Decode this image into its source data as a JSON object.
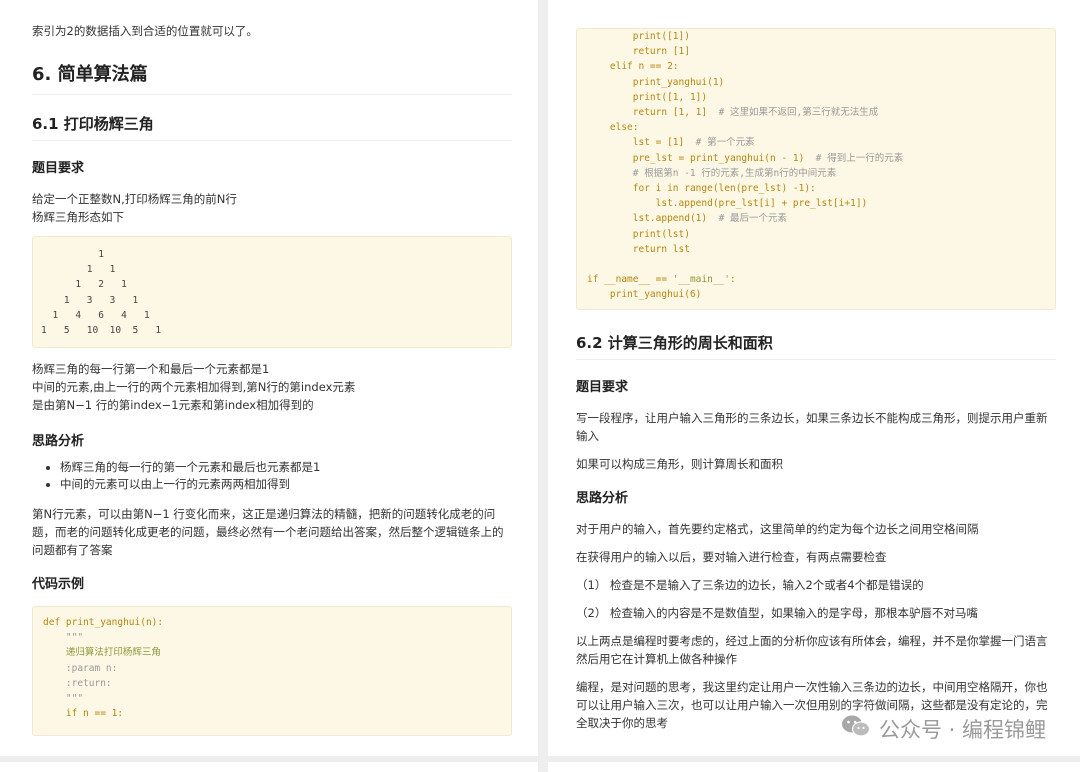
{
  "left": {
    "intro_line": "索引为2的数据插入到合适的位置就可以了。",
    "section_title": "6. 简单算法篇",
    "sub_title": "6.1 打印杨辉三角",
    "req_heading": "题目要求",
    "req_line1": "给定一个正整数N,打印杨辉三角的前N行",
    "req_line2": "杨辉三角形态如下",
    "triangle": "          1\n        1   1\n      1   2   1\n    1   3   3   1\n  1   4   6   4   1\n1   5   10  10  5   1",
    "desc_line1": "杨辉三角的每一行第一个和最后一个元素都是1",
    "desc_line2": "中间的元素,由上一行的两个元素相加得到,第N行的第index元素",
    "desc_line3": "是由第N−1 行的第index−1元素和第index相加得到的",
    "analysis_heading": "思路分析",
    "bullet1": "杨辉三角的每一行的第一个元素和最后也元素都是1",
    "bullet2": "中间的元素可以由上一行的元素两两相加得到",
    "analysis_para": "第N行元素，可以由第N−1 行变化而来，这正是递归算法的精髓，把新的问题转化成老的问题，而老的问题转化成更老的问题，最终必然有一个老问题给出答案，然后整个逻辑链条上的问题都有了答案",
    "code_heading": "代码示例",
    "code_l1": "def print_yanghui(n):",
    "code_l2": "    \"\"\"",
    "code_l3": "    递归算法打印杨辉三角",
    "code_l4": "    :param n:",
    "code_l5": "    :return:",
    "code_l6": "    \"\"\"",
    "code_l7": "    if n == 1:"
  },
  "right": {
    "c1": "        print([1])",
    "c2": "        return [1]",
    "c3": "    elif n == 2:",
    "c4": "        print_yanghui(1)",
    "c5": "        print([1, 1])",
    "c6": "        return [1, 1]  ",
    "c6_comment": "# 这里如果不返回,第三行就无法生成",
    "c7": "    else:",
    "c8": "        lst = [1]  ",
    "c8_comment": "# 第一个元素",
    "c9": "        pre_lst = print_yanghui(n - 1)  ",
    "c9_comment": "# 得到上一行的元素",
    "c10_comment": "        # 根据第n -1 行的元素,生成第n行的中间元素",
    "c11": "        for i in range(len(pre_lst) -1):",
    "c12": "            lst.append(pre_lst[i] + pre_lst[i+1])",
    "c13": "        lst.append(1)  ",
    "c13_comment": "# 最后一个元素",
    "c14": "        print(lst)",
    "c15": "        return lst",
    "c16a": "if __name__ == ",
    "c16b": "'__main__'",
    "c16c": ":",
    "c17": "    print_yanghui(6)",
    "sub_title": "6.2 计算三角形的周长和面积",
    "req_heading": "题目要求",
    "req_para": "写一段程序，让用户输入三角形的三条边长，如果三条边长不能构成三角形，则提示用户重新输入",
    "req_para2": "如果可以构成三角形，则计算周长和面积",
    "analysis_heading": "思路分析",
    "p1": "对于用户的输入，首先要约定格式，这里简单的约定为每个边长之间用空格间隔",
    "p2": "在获得用户的输入以后，要对输入进行检查，有两点需要检查",
    "p3": "（1）  检查是不是输入了三条边的边长，输入2个或者4个都是错误的",
    "p4": "（2）  检查输入的内容是不是数值型，如果输入的是字母，那根本驴唇不对马嘴",
    "p5": "以上两点是编程时要考虑的，经过上面的分析你应该有所体会，编程，并不是你掌握一门语言然后用它在计算机上做各种操作",
    "p6": "编程，是对问题的思考，我这里约定让用户一次性输入三条边的边长，中间用空格隔开，你也可以让用户输入三次，也可以让用户输入一次但用别的字符做间隔，这些都是没有定论的，完全取决于你的思考"
  },
  "watermark": "公众号 · 编程锦鲤",
  "watermark_icon": "wechat-icon"
}
